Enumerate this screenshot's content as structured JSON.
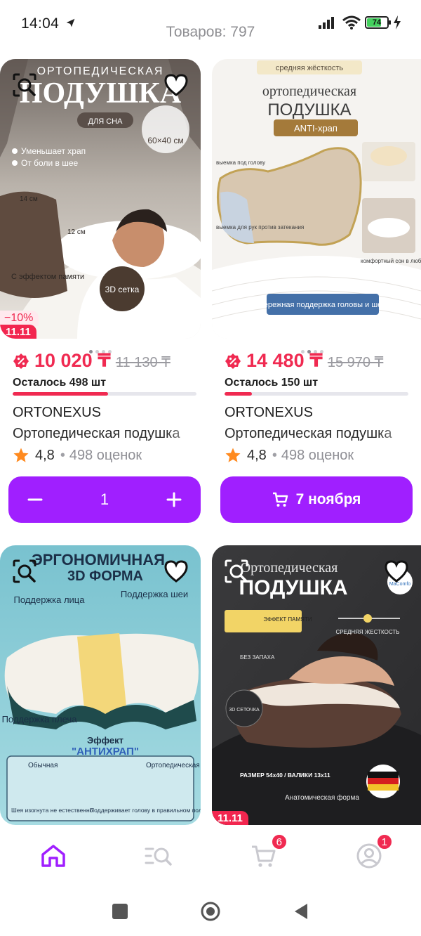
{
  "status_bar": {
    "time": "14:04",
    "battery_level": "74",
    "battery_fraction": 0.74,
    "icons": [
      "notification-silent-icon",
      "signal-icon",
      "wifi-icon",
      "battery-icon",
      "charging-icon"
    ]
  },
  "header": {
    "items_count": "Товаров: 797"
  },
  "products": [
    {
      "image_alt": "Ортопедическая подушка для сна — мужчина спит на подушке",
      "image_text": {
        "top": "ОРТОПЕДИЧЕСКАЯ",
        "big": "ПОДУШКА",
        "chip": "ДЛЯ СНА",
        "size": "60×40 см",
        "bullet1": "Уменьшает храп",
        "bullet2": "От боли в шее",
        "dim1": "14 см",
        "dim2": "12 см",
        "memory": "С эффектом памяти",
        "mesh": "3D сетка"
      },
      "discount": "−10%",
      "promo": "11.11",
      "price": "10 020 ₸",
      "old_price": "11 130 ₸",
      "stock": "Осталось 498 шт",
      "stock_level": 0.52,
      "brand": "ORTONEXUS",
      "title": "Ортопедическая подушка",
      "rating": "4,8",
      "reviews": "498 оценок",
      "cart_quantity": "1"
    },
    {
      "image_alt": "Ортопедическая подушка ANTI-храп",
      "image_text": {
        "chip": "средняя жёсткость",
        "top": "ортопедическая",
        "big": "ПОДУШКА",
        "tag": "ANTI-храп",
        "note1": "выемка под голову",
        "note2": "выемка для рук против затекания",
        "note3": "комфортный сон в любом положении",
        "bottom": "бережная поддержка головы и шеи"
      },
      "price": "14 480 ₸",
      "old_price": "15 970 ₸",
      "stock": "Осталось 150 шт",
      "stock_level": 0.15,
      "brand": "ORTONEXUS",
      "title": "Ортопедическая подушка",
      "rating": "4,8",
      "reviews": "498 оценок",
      "delivery_label": "7 ноября"
    },
    {
      "image_alt": "Эргономичная 3D форма подушки",
      "image_text": {
        "title1": "ЭРГОНОМИЧНАЯ",
        "title2": "3D ФОРМА",
        "face": "Поддержка лица",
        "neck": "Поддержка шеи",
        "shoulder": "Поддержка плеча",
        "effect1": "Эффект",
        "effect2": "\"АНТИХРАП\"",
        "usual": "Обычная",
        "ortho": "Ортопедическая",
        "bad": "Шея изогнута не естественно",
        "good": "Поддерживает голову в правильном положении"
      }
    },
    {
      "image_alt": "Ортопедическая подушка — женщина лежит на подушке",
      "image_text": {
        "top": "Ортопедическая",
        "big": "ПОДУШКА",
        "brand": "MaComfo",
        "memory": "ЭФФЕКТ ПАМЯТИ",
        "firm": "СРЕДНЯЯ ЖЕСТКОСТЬ",
        "smell": "БЕЗ ЗАПАХА",
        "mesh": "3D СЕТОЧКА",
        "size": "РАЗМЕР 54х40 / ВАЛИКИ 13х11",
        "anat": "Анатомическая форма"
      },
      "promo": "11.11"
    }
  ],
  "bottom_nav": {
    "items": [
      {
        "name": "home",
        "icon": "home-icon",
        "active": true
      },
      {
        "name": "catalog",
        "icon": "catalog-search-icon"
      },
      {
        "name": "cart",
        "icon": "cart-icon",
        "badge": "6"
      },
      {
        "name": "profile",
        "icon": "profile-icon",
        "badge": "1"
      }
    ]
  },
  "colors": {
    "accent": "#a01fff",
    "price": "#f02a51",
    "rating_star": "#ff8a1f",
    "nav_active": "#a01fff",
    "nav_inactive": "#c9c9cf"
  }
}
